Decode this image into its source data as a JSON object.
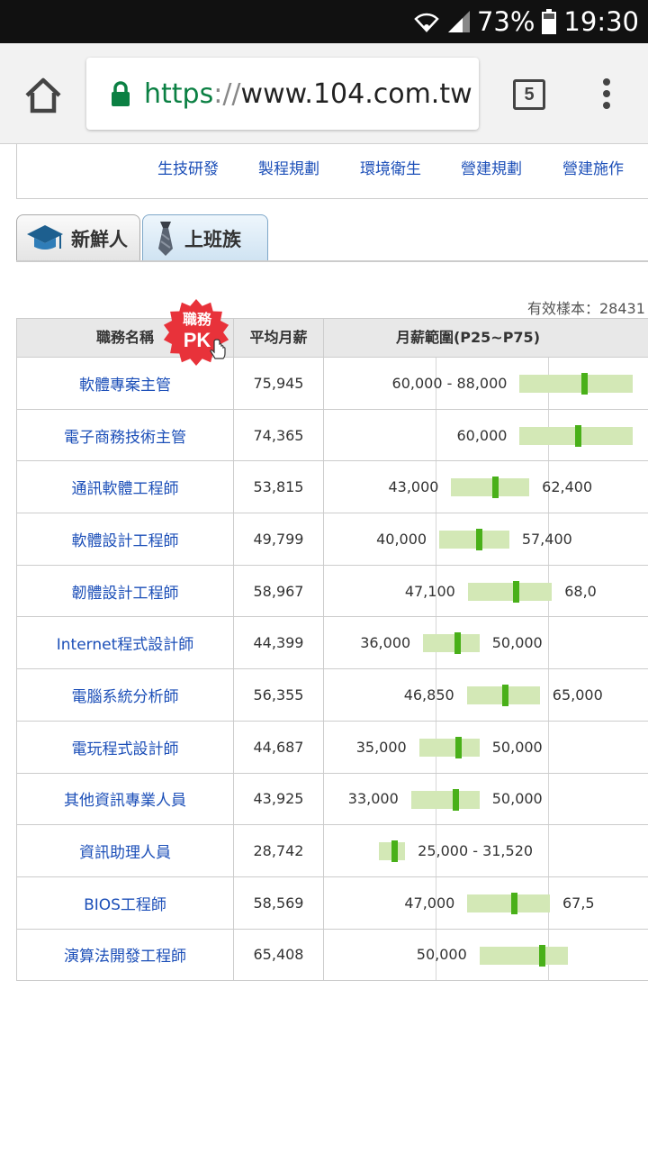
{
  "status_bar": {
    "battery": "73%",
    "time": "19:30"
  },
  "browser": {
    "url_scheme": "https",
    "url_sep": "://",
    "url_host": "www.104.com.tw",
    "tab_count": "5"
  },
  "categories": [
    "生技研發",
    "製程規劃",
    "環境衛生",
    "營建規劃",
    "營建施作"
  ],
  "tabs": {
    "fresh": "新鮮人",
    "work": "上班族"
  },
  "sample_text": "有效樣本：28431",
  "table": {
    "head_name": "職務名稱",
    "head_avg": "平均月薪",
    "head_range": "月薪範圍(P25~P75)",
    "pk_badge_top": "職務",
    "pk_badge_bottom": "PK"
  },
  "rows": [
    {
      "name": "軟體專案主管",
      "avg": "75,945",
      "p25": 60000,
      "p75": 88000,
      "mean": 75945,
      "left_label": "60,000 - 88,000",
      "right_label": ""
    },
    {
      "name": "電子商務技術主管",
      "avg": "74,365",
      "p25": 60000,
      "p75": 88000,
      "mean": 74365,
      "left_label": "60,000",
      "right_label": ""
    },
    {
      "name": "通訊軟體工程師",
      "avg": "53,815",
      "p25": 43000,
      "p75": 62400,
      "mean": 53815,
      "left_label": "43,000",
      "right_label": "62,400"
    },
    {
      "name": "軟體設計工程師",
      "avg": "49,799",
      "p25": 40000,
      "p75": 57400,
      "mean": 49799,
      "left_label": "40,000",
      "right_label": "57,400"
    },
    {
      "name": "韌體設計工程師",
      "avg": "58,967",
      "p25": 47100,
      "p75": 68000,
      "mean": 58967,
      "left_label": "47,100",
      "right_label": "68,0"
    },
    {
      "name": "Internet程式設計師",
      "avg": "44,399",
      "p25": 36000,
      "p75": 50000,
      "mean": 44399,
      "left_label": "36,000",
      "right_label": "50,000"
    },
    {
      "name": "電腦系統分析師",
      "avg": "56,355",
      "p25": 46850,
      "p75": 65000,
      "mean": 56355,
      "left_label": "46,850",
      "right_label": "65,000"
    },
    {
      "name": "電玩程式設計師",
      "avg": "44,687",
      "p25": 35000,
      "p75": 50000,
      "mean": 44687,
      "left_label": "35,000",
      "right_label": "50,000"
    },
    {
      "name": "其他資訊專業人員",
      "avg": "43,925",
      "p25": 33000,
      "p75": 50000,
      "mean": 43925,
      "left_label": "33,000",
      "right_label": "50,000"
    },
    {
      "name": "資訊助理人員",
      "avg": "28,742",
      "p25": 25000,
      "p75": 31520,
      "mean": 28742,
      "left_label": "",
      "right_label": "25,000 - 31,520"
    },
    {
      "name": "BIOS工程師",
      "avg": "58,569",
      "p25": 47000,
      "p75": 67500,
      "mean": 58569,
      "left_label": "47,000",
      "right_label": "67,5"
    },
    {
      "name": "演算法開發工程師",
      "avg": "65,408",
      "p25": 50000,
      "p75": 72000,
      "mean": 65408,
      "left_label": "50,000",
      "right_label": ""
    }
  ],
  "colors": {
    "link": "#1c4fb8",
    "bar": "#d3e8b6",
    "mark": "#49b019"
  }
}
